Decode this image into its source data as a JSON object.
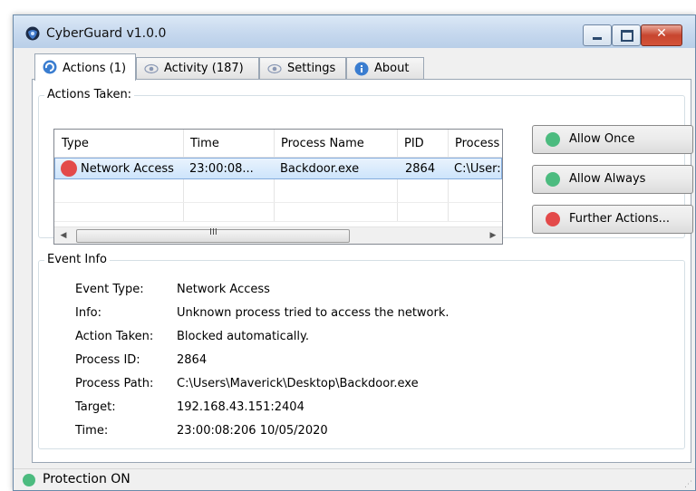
{
  "window": {
    "title": "CyberGuard v1.0.0",
    "close_glyph": "✕"
  },
  "tabs": [
    {
      "label": "Actions (1)",
      "icon": "refresh-icon",
      "active": true
    },
    {
      "label": "Activity (187)",
      "icon": "eye-icon",
      "active": false
    },
    {
      "label": "Settings",
      "icon": "eye-icon",
      "active": false
    },
    {
      "label": "About",
      "icon": "info-icon",
      "active": false
    }
  ],
  "actions_group": {
    "legend": "Actions Taken:",
    "columns": [
      "Type",
      "Time",
      "Process Name",
      "PID",
      "Process"
    ],
    "rows": [
      {
        "type": "Network Access",
        "time": "23:00:08...",
        "process_name": "Backdoor.exe",
        "pid": "2864",
        "process": "C:\\User:",
        "status_color": "#e34a4a"
      }
    ],
    "scroll_grip": "III",
    "scroll_left": "◀",
    "scroll_right": "▶"
  },
  "buttons": {
    "allow_once": {
      "label": "Allow Once",
      "color": "#4cbb7f"
    },
    "allow_always": {
      "label": "Allow Always",
      "color": "#4cbb7f"
    },
    "further_actions": {
      "label": "Further Actions...",
      "color": "#e34a4a"
    }
  },
  "event_info": {
    "legend": "Event Info",
    "fields": [
      {
        "label": "Event Type:",
        "value": "Network Access"
      },
      {
        "label": "Info:",
        "value": "Unknown process tried to access the network."
      },
      {
        "label": "Action Taken:",
        "value": "Blocked automatically."
      },
      {
        "label": "Process ID:",
        "value": "2864"
      },
      {
        "label": "Process Path:",
        "value": "C:\\Users\\Maverick\\Desktop\\Backdoor.exe"
      },
      {
        "label": "Target:",
        "value": "192.168.43.151:2404"
      },
      {
        "label": "Time:",
        "value": "23:00:08:206 10/05/2020"
      }
    ]
  },
  "status": {
    "text": "Protection ON",
    "color": "#4cbb7f"
  }
}
